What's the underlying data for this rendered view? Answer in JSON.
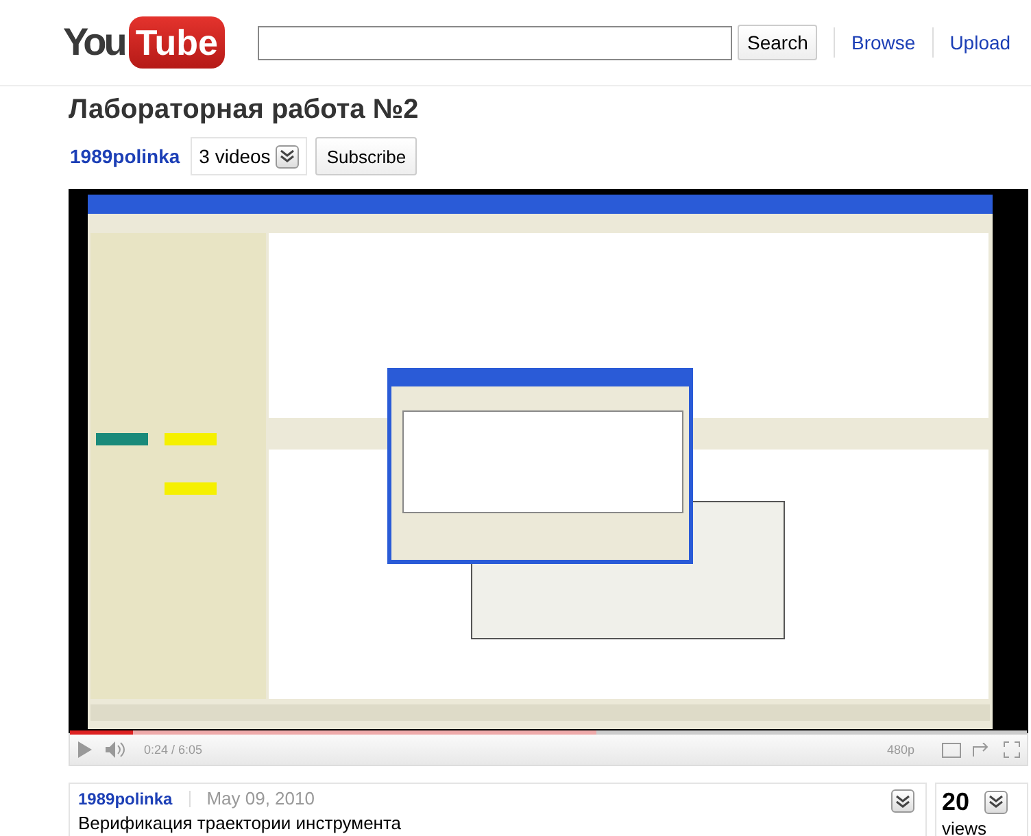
{
  "logo": {
    "plain": "You",
    "boxed": "Tube"
  },
  "search": {
    "button": "Search"
  },
  "nav": [
    "Browse",
    "Upload"
  ],
  "title": "Лабораторная работа №2",
  "channel": {
    "name": "1989polinka",
    "videos": "3 videos",
    "subscribe": "Subscribe"
  },
  "player": {
    "progress": {
      "level": 0.066
    },
    "buffer": {
      "level": 0.55
    },
    "time": "0:24 / 6:05",
    "quality": "480p"
  },
  "info": {
    "author": "1989polinka",
    "date": "May 09, 2010",
    "description": "Верификация траектории инструмента",
    "views_count": "20",
    "views_label": "views"
  }
}
